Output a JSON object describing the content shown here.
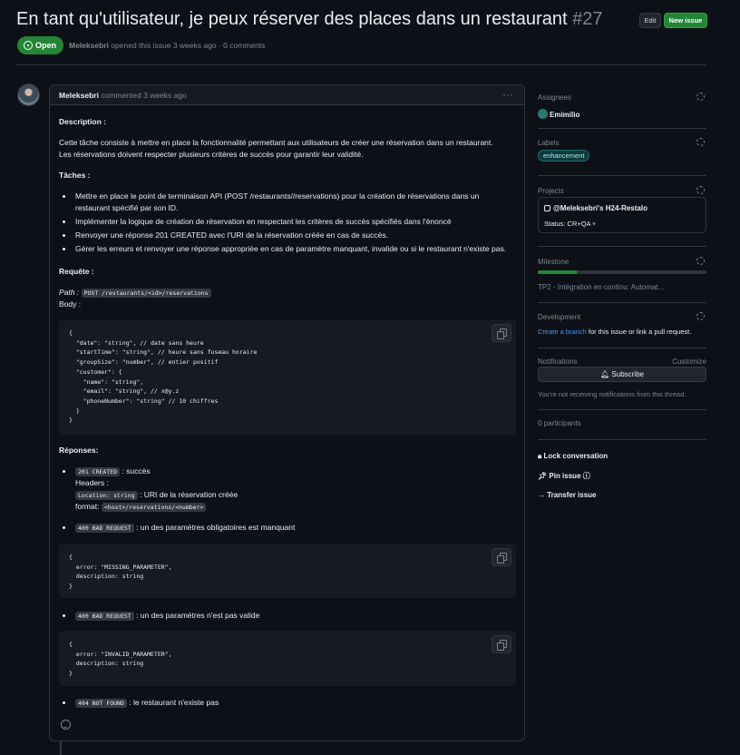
{
  "issue": {
    "title": "En tant qu'utilisateur, je peux réserver des places dans un restaurant",
    "number": "#27",
    "edit_label": "Edit",
    "new_issue_label": "New issue",
    "state": "Open",
    "author": "Meleksebri",
    "meta": "opened this issue 3 weeks ago · 0 comments"
  },
  "comment": {
    "author": "Meleksebri",
    "time": "commented 3 weeks ago",
    "description_heading": "Description :",
    "description_line1": "Cette tâche consiste à mettre en place la fonctionnalité permettant aux utilisateurs de créer une réservation dans un restaurant.",
    "description_line2": "Les réservations doivent respecter plusieurs critères de succès pour garantir leur validité.",
    "tasks_heading": "Tâches :",
    "tasks": [
      "Mettre en place le point de terminaison API (POST /restaurants//reservations) pour la création de réservations dans un",
      "restaurant spécifié par son ID.",
      "Implémenter la logique de création de réservation en respectant les critères de succès spécifiés dans l'énoncé",
      "Renvoyer une réponse 201 CREATED avec l'URI de la réservation créée en cas de succès.",
      "Gérer les erreurs et renvoyer une réponse appropriée en cas de paramètre manquant, invalide ou si le restaurant n'existe pas."
    ],
    "request_heading": "Requête :",
    "path_label": "Path :",
    "path_code": "POST /restaurants/<id>/reservations",
    "body_label": "Body :",
    "body_code": "{\n  \"date\": \"string\", // date sans heure\n  \"startTime\": \"string\", // heure sans fuseau horaire\n  \"groupSize\": \"number\", // entier positif\n  \"customer\": {\n    \"name\": \"string\",\n    \"email\": \"string\", // x@y.z\n    \"phoneNumber\": \"string\" // 10 chiffres\n  }\n}",
    "responses_heading": "Réponses:",
    "r201_code": "201 CREATED",
    "r201_text": ": succès",
    "headers_label": "Headers :",
    "location_code": "Location: string",
    "location_text": ": URI de la réservation créée",
    "format_label": "format:",
    "format_code": "<host>/reservations/<number>",
    "r400a_code": "400 BAD REQUEST",
    "r400a_text": ": un des paramètres obligatoires est manquant",
    "r400a_block": "{\n  error: \"MISSING_PARAMETER\",\n  description: string\n}",
    "r400b_code": "400 BAD REQUEST",
    "r400b_text": ": un des paramètres n'est pas valide",
    "r400b_block": "{\n  error: \"INVALID_PARAMETER\",\n  description: string\n}",
    "r404_code": "404 NOT FOUND",
    "r404_text": ": le restaurant n'existe pas"
  },
  "sidebar": {
    "assignees_title": "Assignees",
    "assignee": "Emimilio",
    "labels_title": "Labels",
    "label": "enhancement",
    "projects_title": "Projects",
    "project_name": "@Meleksebri's H24-Restalo",
    "project_status": "Status: CR+QA",
    "milestone_title": "Milestone",
    "milestone_name": "TP2 - Intégration en continu: Automat...",
    "milestone_progress": 0.23,
    "development_title": "Development",
    "dev_link": "Create a branch",
    "dev_text": "for this issue or link a pull request.",
    "notifications_title": "Notifications",
    "customize_label": "Customize",
    "subscribe_label": "Subscribe",
    "notif_text": "You're not receiving notifications from this thread.",
    "participants": "0 participants",
    "lock_label": "Lock conversation",
    "pin_label": "Pin issue",
    "transfer_label": "Transfer issue"
  },
  "colors": {
    "background": "#0d1117",
    "accent_green": "#238636",
    "link_blue": "#4493f8",
    "label_color": "#a2eeef"
  }
}
